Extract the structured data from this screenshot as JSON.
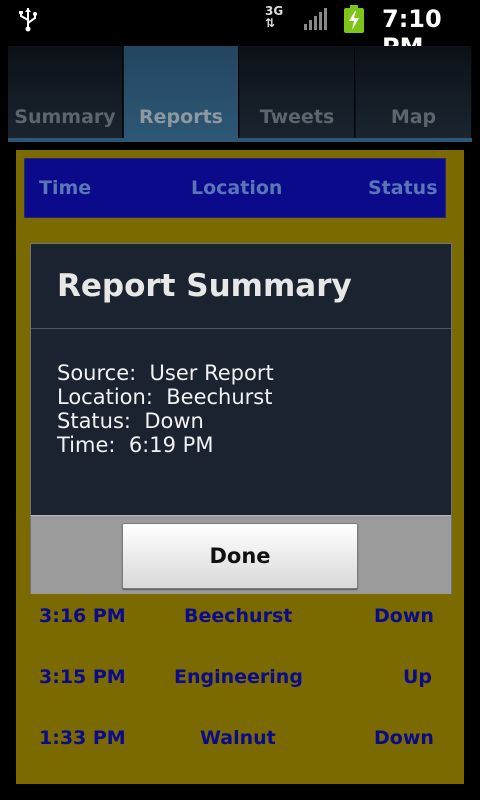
{
  "status_bar": {
    "network": "3G",
    "time": "7:10 PM"
  },
  "tabs": [
    {
      "label": "Summary"
    },
    {
      "label": "Reports",
      "selected": true
    },
    {
      "label": "Tweets"
    },
    {
      "label": "Map"
    }
  ],
  "table": {
    "headers": {
      "time": "Time",
      "location": "Location",
      "status": "Status"
    },
    "rows": [
      {
        "time": "3:16 PM",
        "location": "Beechurst",
        "status": "Down"
      },
      {
        "time": "3:15 PM",
        "location": "Engineering",
        "status": "Up"
      },
      {
        "time": "1:33 PM",
        "location": "Walnut",
        "status": "Down"
      }
    ]
  },
  "dialog": {
    "title": "Report Summary",
    "lines": [
      "Source:  User Report",
      "Location:  Beechurst",
      "Status:  Down",
      "Time:  6:19 PM"
    ],
    "done_label": "Done"
  },
  "colors": {
    "content_bg": "#7a6a00",
    "header_bg": "#0a0a8a",
    "dialog_bg": "#1b2230",
    "accent_tab": "#2d5775"
  }
}
